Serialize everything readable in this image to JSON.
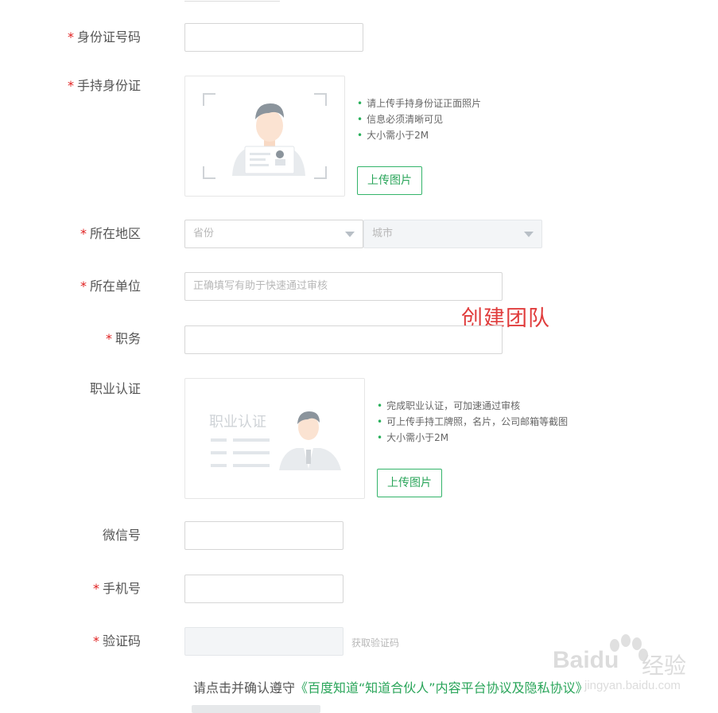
{
  "form": {
    "required_mark": "*",
    "id_number": {
      "label": "身份证号码",
      "value": ""
    },
    "id_photo": {
      "label": "手持身份证",
      "tips": [
        "请上传手持身份证正面照片",
        "信息必须清晰可见",
        "大小需小于2M"
      ],
      "upload_label": "上传图片"
    },
    "region": {
      "label": "所在地区",
      "province_placeholder": "省份",
      "city_placeholder": "城市"
    },
    "org": {
      "label": "所在单位",
      "placeholder": "正确填写有助于快速通过审核"
    },
    "position": {
      "label": "职务",
      "value": ""
    },
    "career_cert": {
      "label": "职业认证",
      "illustration_text": "职业认证",
      "tips": [
        "完成职业认证，可加速通过审核",
        "可上传手持工牌照，名片，公司邮箱等截图",
        "大小需小于2M"
      ],
      "upload_label": "上传图片"
    },
    "wechat": {
      "label": "微信号",
      "value": ""
    },
    "phone": {
      "label": "手机号",
      "value": ""
    },
    "captcha": {
      "label": "验证码",
      "get_code_label": "获取验证码"
    }
  },
  "agreement": {
    "prefix": "请点击并确认遵守",
    "link": "《百度知道“知道合伙人”内容平台协议及隐私协议》"
  },
  "annotation": {
    "text": "创建团队"
  },
  "watermark": {
    "brand": "Baidu",
    "brand_cn": "经验",
    "url": "jingyan.baidu.com"
  },
  "colors": {
    "accent": "#2aa55a",
    "required": "#e02020",
    "annotation": "#e03c3c"
  }
}
